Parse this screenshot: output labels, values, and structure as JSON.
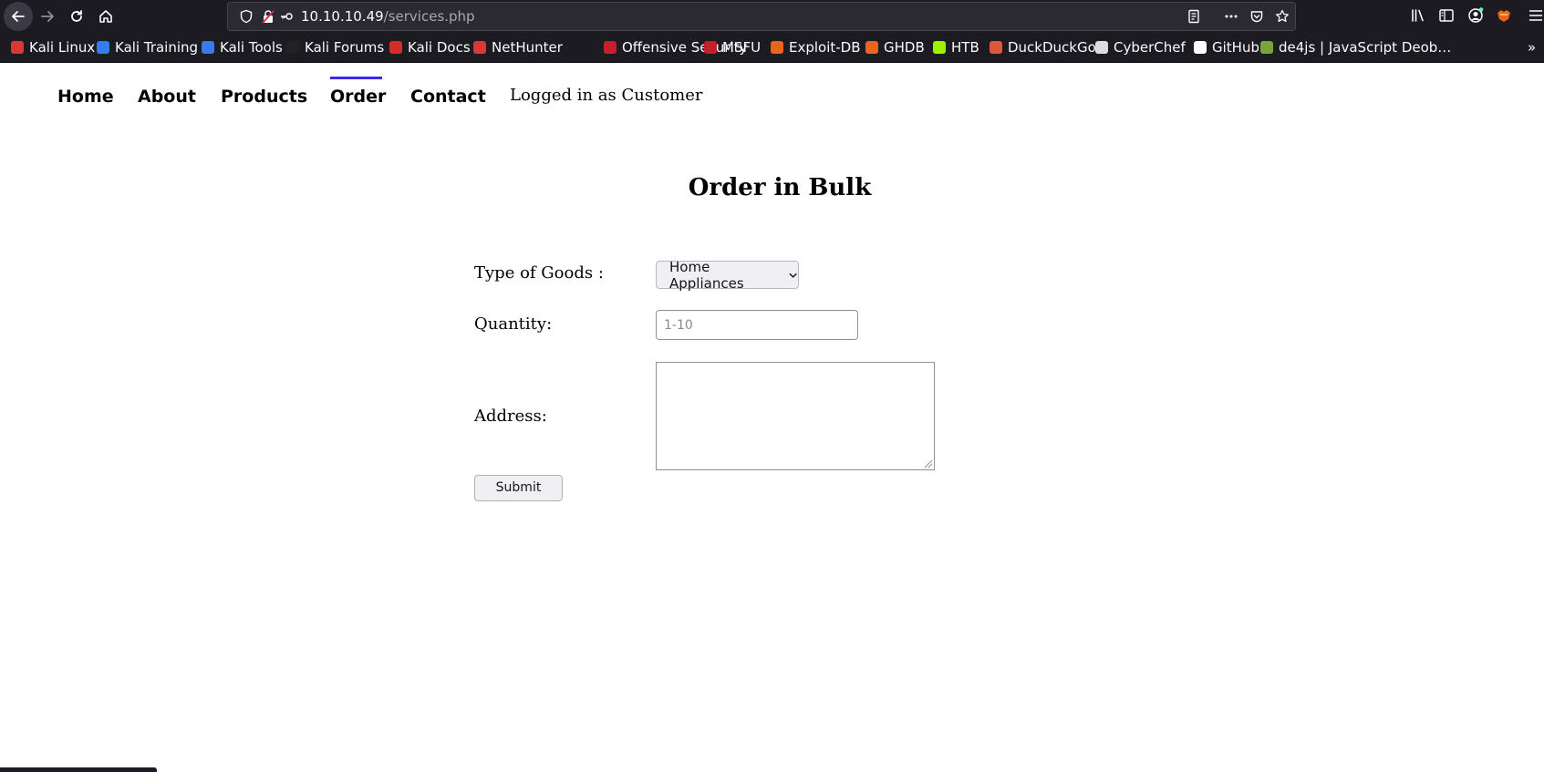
{
  "browser": {
    "url_host": "10.10.10.49",
    "url_path": "/services.php",
    "bookmarks": [
      {
        "label": "Kali Linux",
        "icon": "kali-dragon-icon",
        "color": "#d6383b"
      },
      {
        "label": "Kali Training",
        "icon": "kali-training-icon",
        "color": "#367bf0"
      },
      {
        "label": "Kali Tools",
        "icon": "kali-tools-icon",
        "color": "#367bf0"
      },
      {
        "label": "Kali Forums",
        "icon": "kali-forums-icon",
        "color": "#222222"
      },
      {
        "label": "Kali Docs",
        "icon": "kali-docs-icon",
        "color": "#d62b2b"
      },
      {
        "label": "NetHunter",
        "icon": "nethunter-icon",
        "color": "#d6383b"
      },
      {
        "label": "Offensive Security",
        "icon": "offsec-icon",
        "color": "#c3202c"
      },
      {
        "label": "MSFU",
        "icon": "msfu-icon",
        "color": "#c3202c"
      },
      {
        "label": "Exploit-DB",
        "icon": "exploit-db-icon",
        "color": "#e8651a"
      },
      {
        "label": "GHDB",
        "icon": "ghdb-icon",
        "color": "#e8651a"
      },
      {
        "label": "HTB",
        "icon": "htb-cube-icon",
        "color": "#9fef00"
      },
      {
        "label": "DuckDuckGo",
        "icon": "duckduckgo-icon",
        "color": "#de5833"
      },
      {
        "label": "CyberChef",
        "icon": "cyberchef-icon",
        "color": "#dddddd"
      },
      {
        "label": "GitHub",
        "icon": "github-icon",
        "color": "#ffffff"
      },
      {
        "label": "de4js | JavaScript Deob…",
        "icon": "de4js-icon",
        "color": "#7aa33a"
      }
    ]
  },
  "nav": {
    "items": [
      "Home",
      "About",
      "Products",
      "Order",
      "Contact"
    ],
    "active": "Order",
    "login_status": "Logged in as Customer"
  },
  "form": {
    "title": "Order in Bulk",
    "goods_label": "Type of Goods :",
    "goods_selected": "Home Appliances",
    "quantity_label": "Quantity:",
    "quantity_placeholder": "1-10",
    "address_label": "Address:",
    "submit_label": "Submit"
  },
  "colors": {
    "chrome_bg": "#1c1b22",
    "urlbar_bg": "#2b2a33",
    "active_nav_underline": "#3b28e8"
  }
}
